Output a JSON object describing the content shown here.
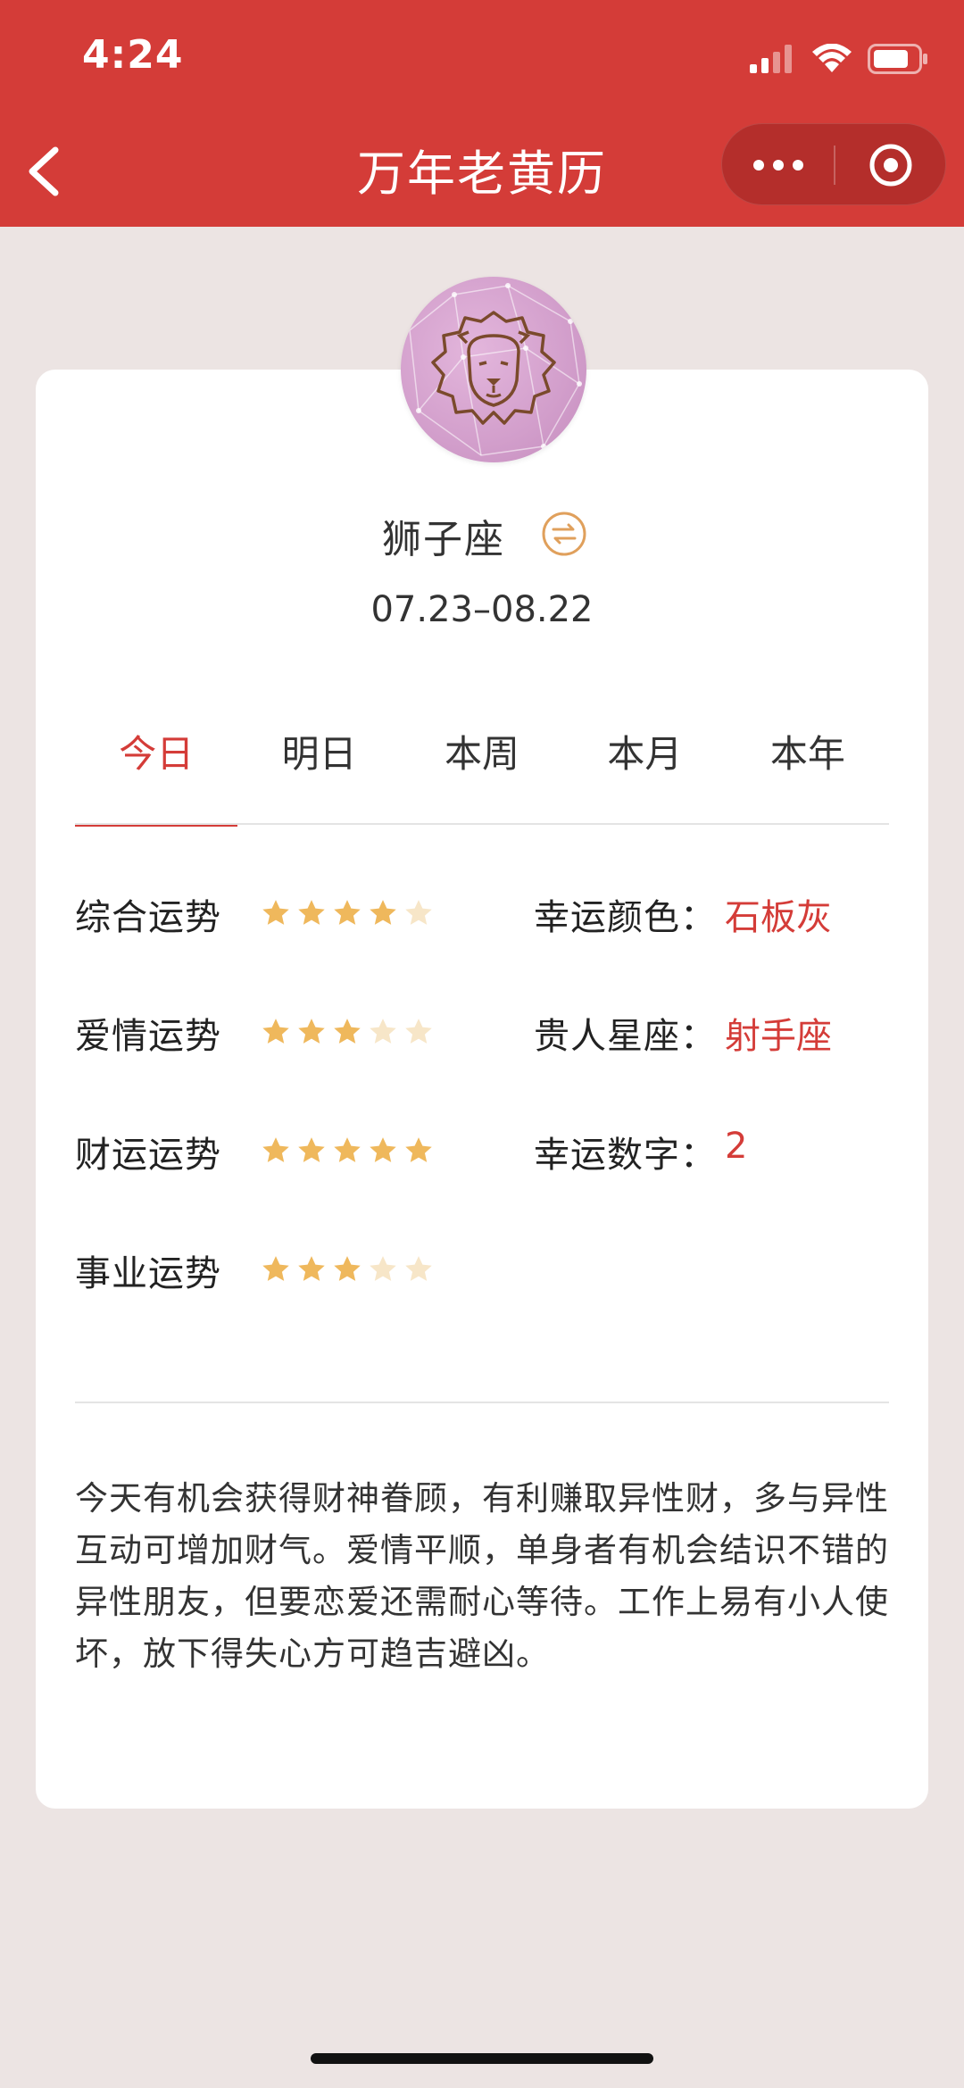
{
  "status_bar": {
    "time": "4:24"
  },
  "nav": {
    "title": "万年老黄历",
    "back_icon": "chevron-left-icon",
    "more_icon": "more-dots-icon",
    "close_icon": "target-circle-icon"
  },
  "colors": {
    "brand": "#d43c38",
    "star_filled": "#efb85c",
    "star_empty": "#f7e6c8",
    "avatar": "#d29ecb",
    "background": "#ece4e3"
  },
  "sign": {
    "name": "狮子座",
    "date_range": "07.23–08.22",
    "avatar_icon": "lion-icon",
    "switch_icon": "switch-arrows-icon"
  },
  "tabs": [
    {
      "label": "今日",
      "active": true
    },
    {
      "label": "明日",
      "active": false
    },
    {
      "label": "本周",
      "active": false
    },
    {
      "label": "本月",
      "active": false
    },
    {
      "label": "本年",
      "active": false
    }
  ],
  "fortunes": [
    {
      "label": "综合运势",
      "rating": 4,
      "max": 5
    },
    {
      "label": "爱情运势",
      "rating": 3,
      "max": 5
    },
    {
      "label": "财运运势",
      "rating": 5,
      "max": 5
    },
    {
      "label": "事业运势",
      "rating": 3,
      "max": 5
    }
  ],
  "lucky": [
    {
      "label": "幸运颜色：",
      "value": "石板灰"
    },
    {
      "label": "贵人星座：",
      "value": "射手座"
    },
    {
      "label": "幸运数字：",
      "value": "2"
    }
  ],
  "description": "今天有机会获得财神眷顾，有利赚取异性财，多与异性互动可增加财气。爱情平顺，单身者有机会结识不错的异性朋友，但要恋爱还需耐心等待。工作上易有小人使坏，放下得失心方可趋吉避凶。"
}
